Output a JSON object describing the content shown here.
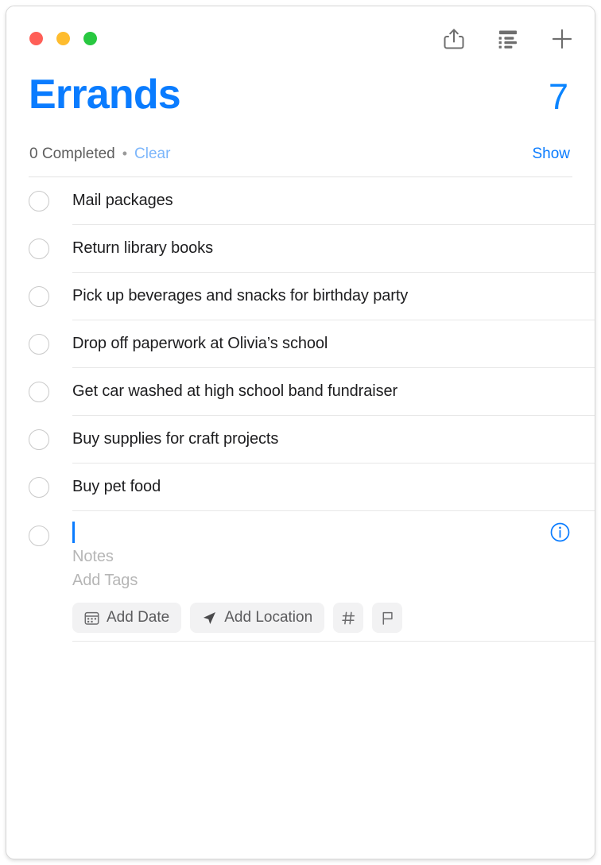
{
  "window": {
    "traffic_lights": [
      {
        "name": "close",
        "color": "#ff5f57"
      },
      {
        "name": "minimize",
        "color": "#febc2e"
      },
      {
        "name": "zoom",
        "color": "#28c840"
      }
    ],
    "toolbar": [
      {
        "icon": "share-icon",
        "label": "Share"
      },
      {
        "icon": "view-options-icon",
        "label": "View Options"
      },
      {
        "icon": "plus-icon",
        "label": "New Reminder"
      }
    ]
  },
  "header": {
    "title": "Errands",
    "count": "7",
    "accent_color": "#0a7cff"
  },
  "completed_bar": {
    "completed_text": "0 Completed",
    "separator": "•",
    "clear_label": "Clear",
    "show_label": "Show"
  },
  "reminders": [
    {
      "text": "Mail packages",
      "checked": false
    },
    {
      "text": "Return library books",
      "checked": false
    },
    {
      "text": "Pick up beverages and snacks for birthday party",
      "checked": false
    },
    {
      "text": "Drop off paperwork at Olivia’s school",
      "checked": false
    },
    {
      "text": "Get car washed at high school band fundraiser",
      "checked": false
    },
    {
      "text": "Buy supplies for craft projects",
      "checked": false
    },
    {
      "text": "Buy pet food",
      "checked": false
    }
  ],
  "new_reminder": {
    "title_value": "",
    "notes_placeholder": "Notes",
    "tags_placeholder": "Add Tags",
    "chips": [
      {
        "icon": "calendar-icon",
        "label": "Add Date"
      },
      {
        "icon": "location-icon",
        "label": "Add Location"
      },
      {
        "icon": "hashtag-icon",
        "label": "#"
      },
      {
        "icon": "flag-icon",
        "label": ""
      }
    ],
    "info_label": "i"
  }
}
